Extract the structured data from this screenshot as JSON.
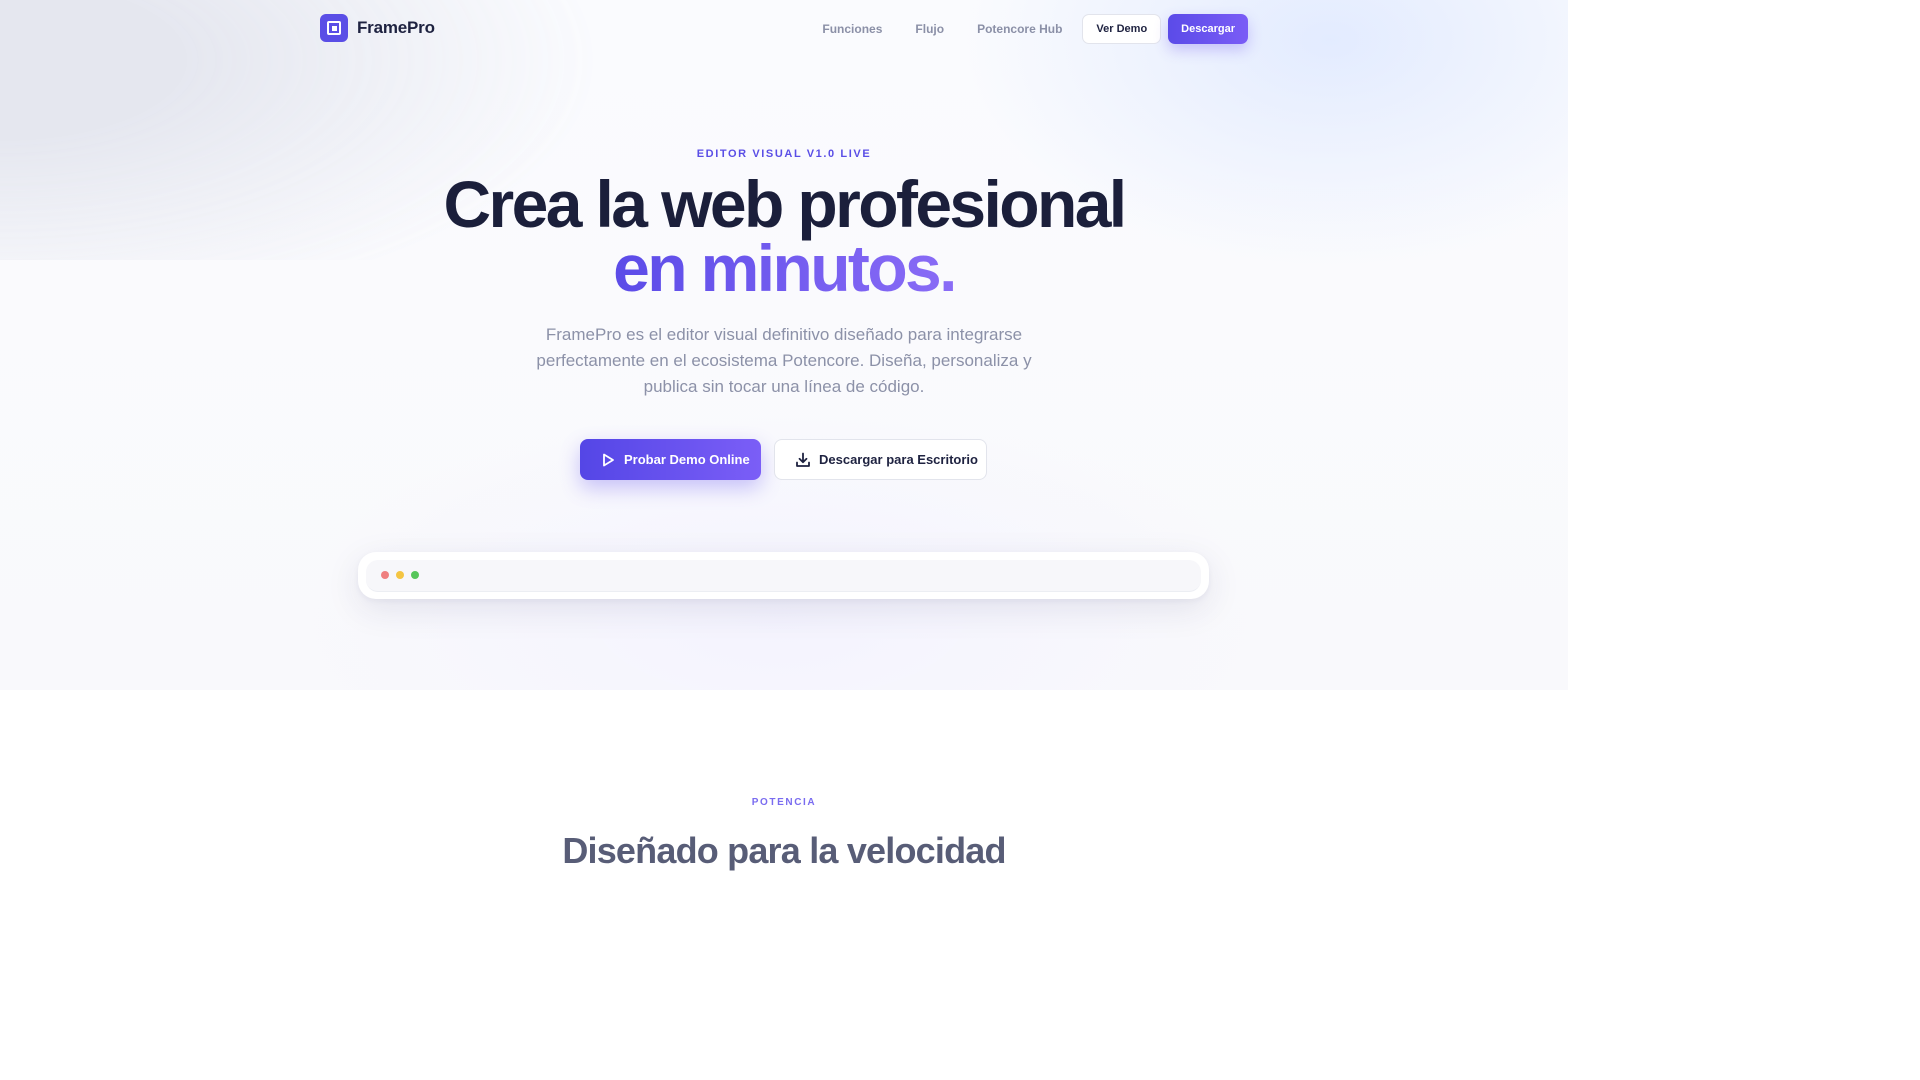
{
  "nav": {
    "brand": "FramePro",
    "links": [
      "Funciones",
      "Flujo",
      "Potencore Hub"
    ],
    "demo_label": "Ver Demo",
    "download_label": "Descargar"
  },
  "hero": {
    "eyebrow": "EDITOR VISUAL V1.0 LIVE",
    "title_line1": "Crea la web profesional",
    "title_line2": "en minutos.",
    "subtitle": "FramePro es el editor visual definitivo diseñado para integrarse perfectamente en el ecosistema Potencore. Diseña, personaliza y publica sin tocar una línea de código.",
    "cta_primary": "Probar Demo Online",
    "cta_secondary": "Descargar para Escritorio"
  },
  "features": {
    "eyebrow": "POTENCIA",
    "title": "Diseñado para la velocidad"
  },
  "colors": {
    "accent": "#5a4ee6",
    "accent_light": "#7b5ef7",
    "text_dark": "#1b1f3b",
    "text_muted": "#8c91a8",
    "dot_red": "#ef7f7f",
    "dot_yellow": "#f4c542",
    "dot_green": "#56c65a"
  },
  "icons": {
    "logo": "frame-logo-icon",
    "play": "play-icon",
    "download": "download-icon"
  }
}
